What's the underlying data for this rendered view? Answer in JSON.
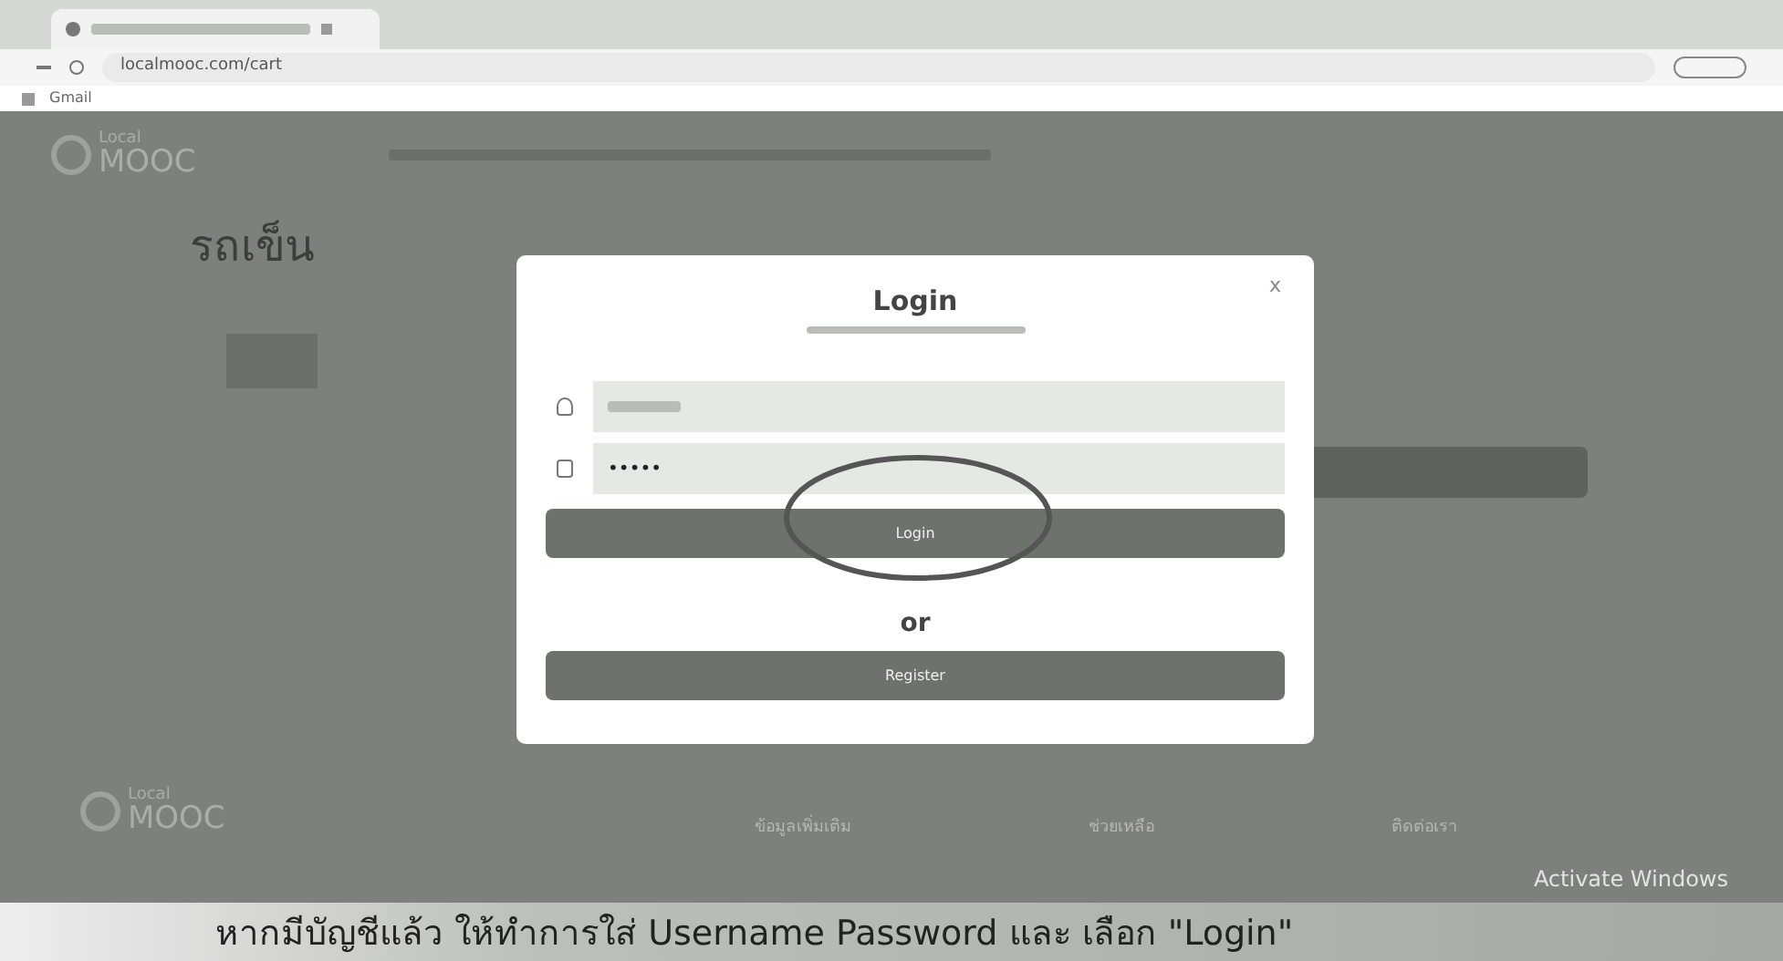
{
  "browser": {
    "url": "localmooc.com/cart",
    "bookmarks": [
      "Gmail"
    ]
  },
  "site": {
    "logo": {
      "line1": "Local",
      "line2": "MOOC"
    },
    "page_title": "รถเข็น"
  },
  "login_dialog": {
    "close": "x",
    "title": "Login",
    "password_value": "•••••",
    "login_button": "Login",
    "separator": "or",
    "register_button": "Register"
  },
  "footer": {
    "logo": {
      "line1": "Local",
      "line2": "MOOC"
    },
    "headings": [
      "ข้อมูลเพิ่มเติม",
      "ช่วยเหลือ",
      "ติดต่อเรา"
    ]
  },
  "os_notice": "Activate Windows",
  "caption": "หากมีบัญชีแล้ว ให้ทำการใส่ Username Password และ เลือก \"Login\""
}
